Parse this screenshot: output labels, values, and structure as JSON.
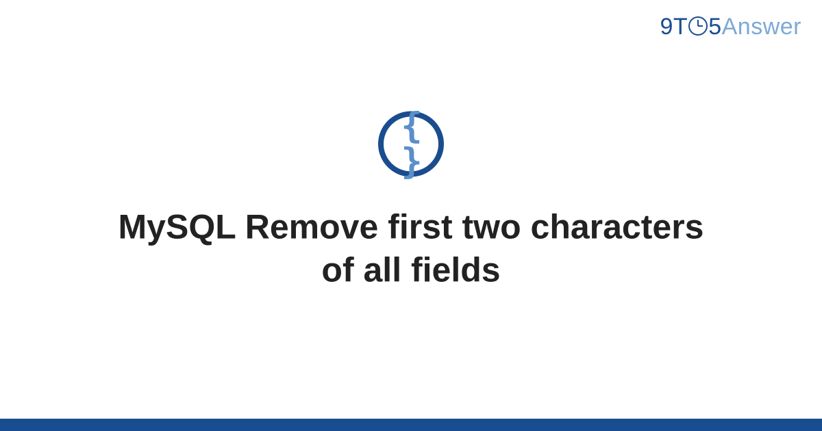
{
  "logo": {
    "prefix": "9T",
    "middle": "5",
    "suffix": "Answer"
  },
  "icon": {
    "braces": "{ }"
  },
  "title": "MySQL Remove first two characters of all fields",
  "colors": {
    "primary": "#1a4d8f",
    "secondary": "#7ca9d6",
    "icon_inner": "#5a8fc9"
  }
}
